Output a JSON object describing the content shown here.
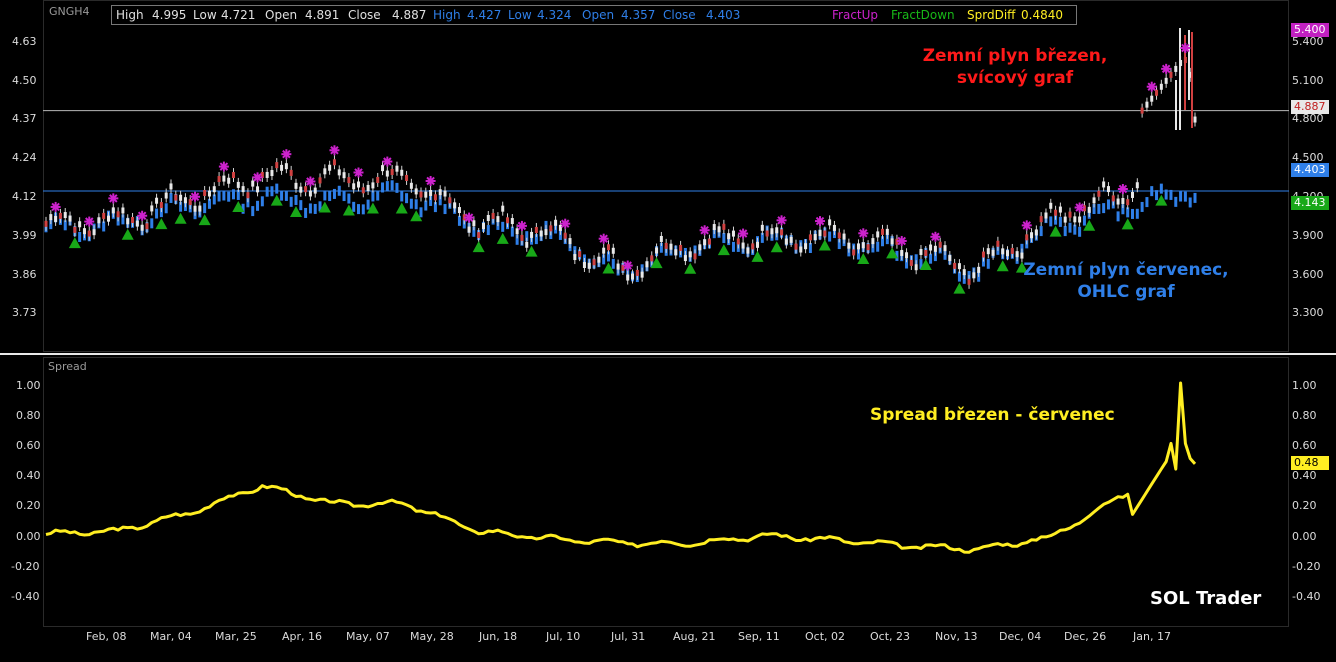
{
  "header": {
    "symbol": "GNGH4",
    "candles": {
      "high_label": "High",
      "high": "4.995",
      "low_label": "Low",
      "low": "4.721",
      "open_label": "Open",
      "open": "4.891",
      "close_label": "Close",
      "close": "4.887"
    },
    "ohlc": {
      "high_label": "High",
      "high": "4.427",
      "low_label": "Low",
      "low": "4.324",
      "open_label": "Open",
      "open": "4.357",
      "close_label": "Close",
      "close": "4.403"
    },
    "fract_up": "FractUp",
    "fract_down": "FractDown",
    "sprd_label": "SprdDiff",
    "sprd_value": "0.4840"
  },
  "spread_panel_title": "Spread",
  "left_axis_top": [
    "4.63",
    "4.50",
    "4.37",
    "4.24",
    "4.12",
    "3.99",
    "3.86",
    "3.73"
  ],
  "right_axis_top": [
    "5.400",
    "5.100",
    "4.800",
    "4.500",
    "4.200",
    "3.900",
    "3.600",
    "3.300"
  ],
  "left_axis_bottom": [
    "1.00",
    "0.80",
    "0.60",
    "0.40",
    "0.20",
    "0.00",
    "-0.20",
    "-0.40"
  ],
  "right_axis_bottom": [
    "1.00",
    "0.80",
    "0.60",
    "0.40",
    "0.20",
    "0.00",
    "-0.20",
    "-0.40"
  ],
  "date_labels": [
    "Feb, 08",
    "Mar, 04",
    "Mar, 25",
    "Apr, 16",
    "May, 07",
    "May, 28",
    "Jun, 18",
    "Jul, 10",
    "Jul, 31",
    "Aug, 21",
    "Sep, 11",
    "Oct, 02",
    "Oct, 23",
    "Nov, 13",
    "Dec, 04",
    "Dec, 26",
    "Jan, 17"
  ],
  "price_labels": {
    "high_marker": "5.400",
    "close_candles": "4.887",
    "close_ohlc": "4.403",
    "low_marker": "4.143",
    "spread_last": "0.48"
  },
  "annotations": {
    "march_line1": "Zemní plyn březen,",
    "march_line2": "svícový graf",
    "july_line1": "Zemní plyn červenec,",
    "july_line2": "OHLC graf",
    "spread": "Spread březen - červenec",
    "brand": "SOL Trader"
  },
  "colors": {
    "candles": "#d4d4d4",
    "ohlc": "#2f7fe8",
    "spread": "#ffee22",
    "fract_up": "#cc22cc",
    "fract_down": "#18a818",
    "march_text": "#ff1a1a",
    "july_text": "#2f7fe8"
  },
  "chart_data": [
    {
      "type": "candlestick",
      "title": "Zemní plyn březen, svícový graf",
      "y_axis": "left",
      "ylim": [
        3.66,
        4.7
      ],
      "series": [
        {
          "name": "Zemní plyn březen",
          "style": "candles",
          "x": [
            "Feb, 08",
            "Mar, 04",
            "Mar, 25",
            "Apr, 16",
            "May, 07",
            "May, 28",
            "Jun, 18",
            "Jul, 10",
            "Jul, 31",
            "Aug, 21",
            "Sep, 11",
            "Oct, 02",
            "Oct, 23",
            "Nov, 13",
            "Dec, 04",
            "Dec, 26",
            "Jan, 17"
          ],
          "close": [
            4.05,
            4.06,
            4.14,
            4.21,
            4.2,
            4.2,
            4.06,
            4.02,
            3.9,
            3.99,
            4.01,
            4.0,
            3.96,
            3.9,
            4.07,
            4.15,
            4.43
          ],
          "last": {
            "high": 4.995,
            "low": 4.721,
            "open": 4.891,
            "close": 4.887
          }
        },
        {
          "name": "Zemní plyn červenec",
          "style": "ohlc",
          "x": [
            "Feb, 08",
            "Mar, 04",
            "Mar, 25",
            "Apr, 16",
            "May, 07",
            "May, 28",
            "Jun, 18",
            "Jul, 10",
            "Jul, 31",
            "Aug, 21",
            "Sep, 11",
            "Oct, 02",
            "Oct, 23",
            "Nov, 13",
            "Dec, 04",
            "Dec, 26",
            "Jan, 17"
          ],
          "close": [
            4.03,
            4.05,
            4.11,
            4.14,
            4.12,
            4.15,
            4.04,
            4.01,
            3.89,
            3.98,
            4.0,
            3.99,
            3.95,
            3.89,
            4.04,
            4.1,
            4.16
          ],
          "last": {
            "high": 4.427,
            "low": 4.324,
            "open": 4.357,
            "close": 4.403
          }
        }
      ]
    },
    {
      "type": "line",
      "title": "Spread březen - červenec",
      "ylim": [
        -0.48,
        1.08
      ],
      "x": [
        "Feb, 08",
        "Mar, 04",
        "Mar, 25",
        "Apr, 16",
        "May, 07",
        "May, 28",
        "Jun, 18",
        "Jul, 10",
        "Jul, 31",
        "Aug, 21",
        "Sep, 11",
        "Oct, 02",
        "Oct, 23",
        "Nov, 13",
        "Dec, 04",
        "Dec, 26",
        "Jan, 17"
      ],
      "series": [
        {
          "name": "Spread",
          "values": [
            0.02,
            0.04,
            0.16,
            0.34,
            0.22,
            0.22,
            0.04,
            -0.01,
            -0.04,
            -0.04,
            0.01,
            -0.02,
            -0.06,
            -0.08,
            0.0,
            0.28,
            0.45
          ]
        }
      ],
      "last": 0.484
    }
  ]
}
